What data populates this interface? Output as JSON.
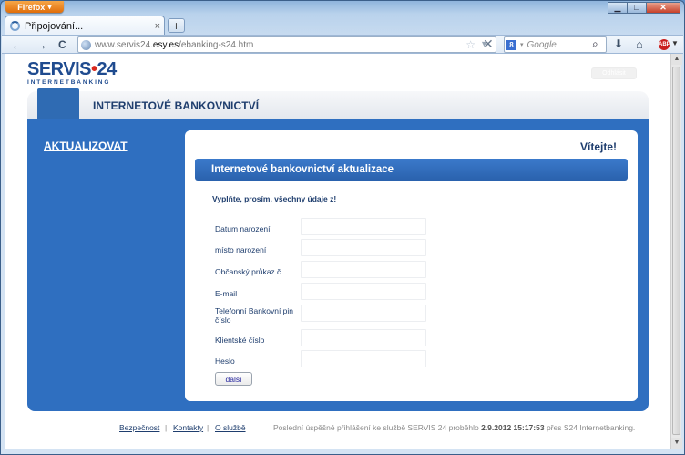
{
  "browser": {
    "menu_label": "Firefox",
    "window_controls": {
      "minimize": "▁",
      "maximize": "□",
      "close": "✕"
    },
    "tab": {
      "title": "Připojování...",
      "close": "×"
    },
    "new_tab": "+",
    "nav": {
      "back": "←",
      "forward": "→",
      "reload": "C"
    },
    "url": {
      "prefix": "www.servis24.",
      "domain": "esy.es",
      "path": "/ebanking-s24.htm"
    },
    "search": {
      "engine_badge": "8",
      "placeholder": "Google"
    },
    "icons": [
      "back-icon",
      "forward-icon",
      "reload-icon",
      "globe-icon",
      "bookmark-star-icon",
      "stop-icon",
      "search-icon",
      "download-icon",
      "home-icon",
      "adblock-icon"
    ]
  },
  "site": {
    "logo_main": "SERVIS",
    "logo_dot": "•",
    "logo_num": "24",
    "logo_sub": "INTERNETBANKING",
    "logout_label": "Odhlásit",
    "header_title": "INTERNETOVÉ BANKOVNICTVÍ",
    "side_link": "AKTUALIZOVAT"
  },
  "form": {
    "welcome": "Vítejte!",
    "title": "Internetové bankovnictví aktualizace",
    "instruction": "Vyplňte, prosím, všechny údaje z!",
    "fields": [
      {
        "label": "Datum narození",
        "value": ""
      },
      {
        "label": "místo narození",
        "value": ""
      },
      {
        "label": "Občanský průkaz č.",
        "value": ""
      },
      {
        "label": "E-mail",
        "value": ""
      },
      {
        "label": "Telefonní Bankovní pin číslo",
        "value": ""
      },
      {
        "label": "Klientské číslo",
        "value": ""
      },
      {
        "label": "Heslo",
        "value": ""
      }
    ],
    "submit_label": "další"
  },
  "footer": {
    "links": [
      "Bezpečnost",
      "Kontakty",
      "O službě"
    ],
    "separator": "|",
    "note_prefix": "Poslední úspěšné přihlášení ke službě SERVIS 24 proběhlo",
    "note_datetime": "2.9.2012 15:17:53",
    "note_suffix": "přes S24 Internetbanking."
  }
}
